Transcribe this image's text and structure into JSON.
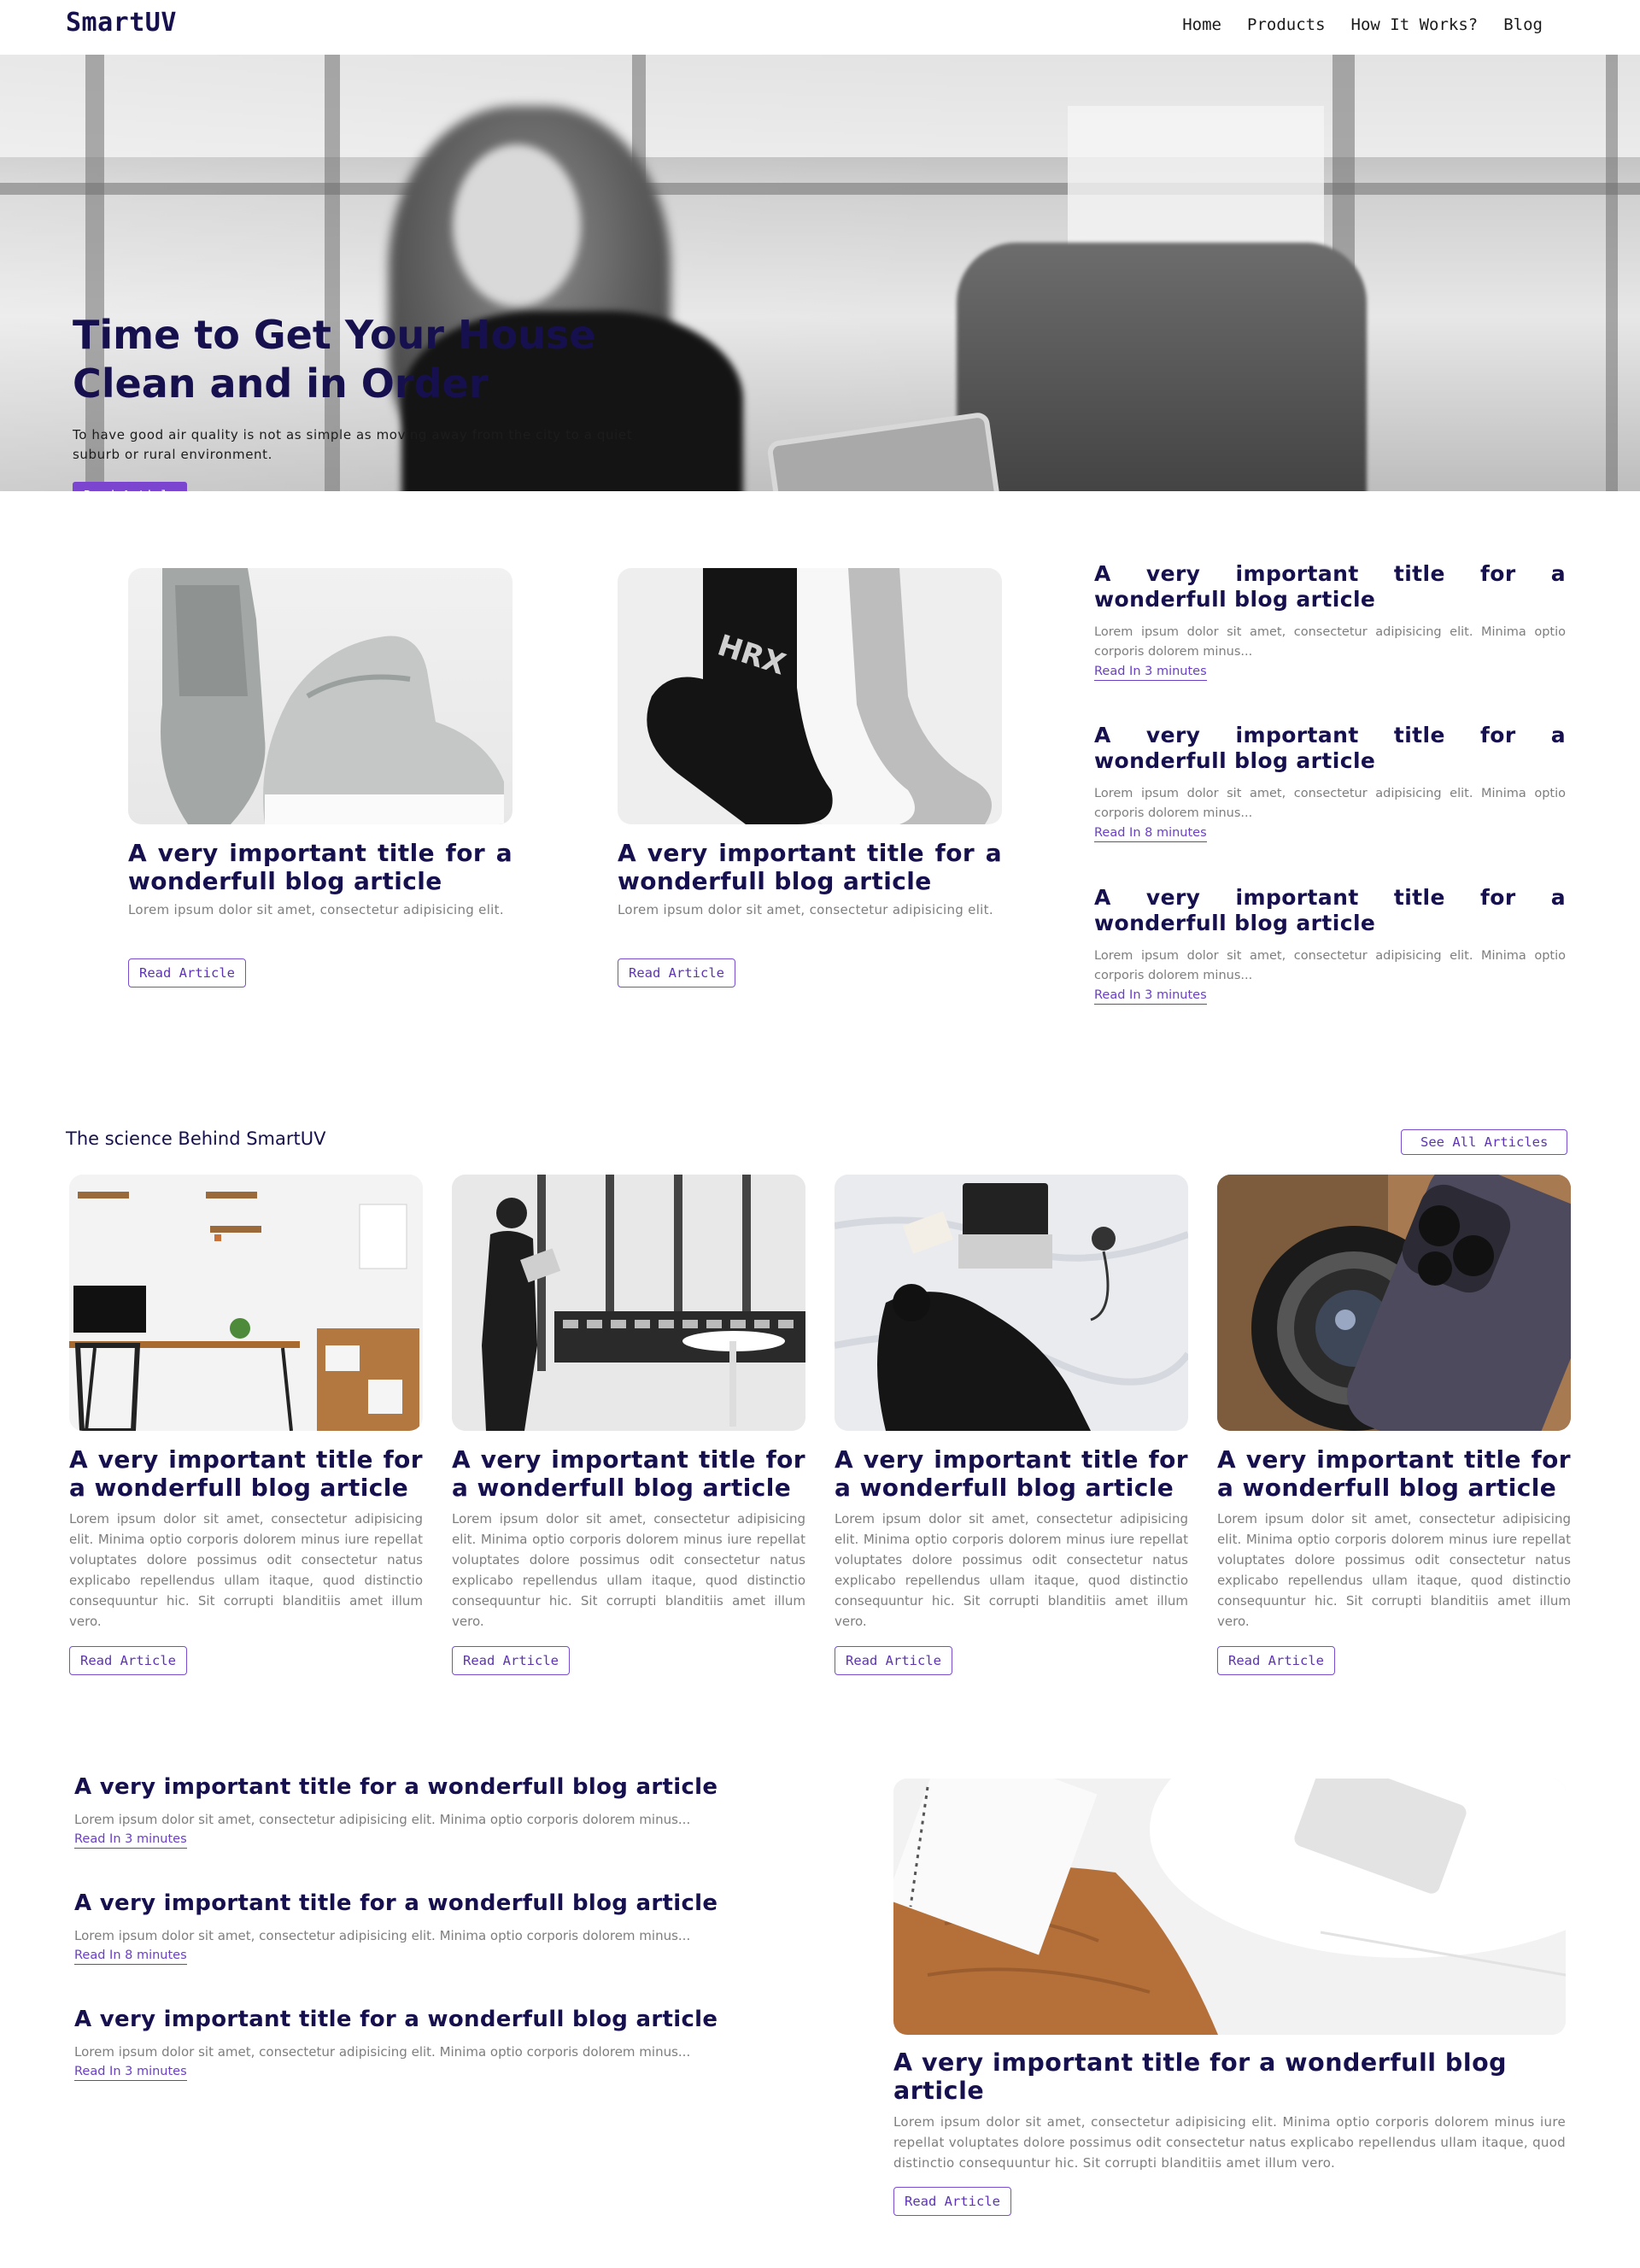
{
  "nav": {
    "logo": "SmartUV",
    "links": [
      "Home",
      "Products",
      "How It Works?",
      "Blog"
    ]
  },
  "hero": {
    "title_line1": "Time to Get Your House",
    "title_line2": "Clean and in Order",
    "text": "To have good air quality is not as simple as moving away from the city to a quiet suburb or rural environment.",
    "button": "Read Article"
  },
  "featured": {
    "cards": [
      {
        "image": "sneaker-photo",
        "title": "A very important title for a wonderfull blog article",
        "text": "Lorem ipsum dolor sit amet, consectetur adipisicing elit.",
        "button": "Read Article"
      },
      {
        "image": "socks-photo",
        "title": "A very important title for a wonderfull blog article",
        "text": "Lorem ipsum dolor sit amet, consectetur adipisicing elit.",
        "button": "Read Article"
      }
    ],
    "side": [
      {
        "title": "A very important title for a wonderfull blog article",
        "text": "Lorem ipsum dolor sit amet, consectetur adipisicing elit. Minima optio corporis dolorem minus...",
        "link": "Read In 3 minutes"
      },
      {
        "title": "A very important title for a wonderfull blog article",
        "text": "Lorem ipsum dolor sit amet, consectetur adipisicing elit. Minima optio corporis dolorem minus...",
        "link": "Read In 8 minutes"
      },
      {
        "title": "A very important title for a wonderfull blog article",
        "text": "Lorem ipsum dolor sit amet, consectetur adipisicing elit. Minima optio corporis dolorem minus...",
        "link": "Read In 3 minutes"
      }
    ]
  },
  "science": {
    "heading": "The science Behind SmartUV",
    "see_all": "See All Articles",
    "cards": [
      {
        "title": "A very important title for a wonderfull blog article",
        "text": "Lorem ipsum dolor sit amet, consectetur adipisicing elit. Minima optio corporis dolorem minus iure repellat voluptates dolore possimus odit consectetur natus explicabo repellendus ullam itaque, quod distinctio consequuntur hic. Sit corrupti blanditiis amet illum vero.",
        "button": "Read Article"
      },
      {
        "title": "A very important title for a wonderfull blog article",
        "text": "Lorem ipsum dolor sit amet, consectetur adipisicing elit. Minima optio corporis dolorem minus iure repellat voluptates dolore possimus odit consectetur natus explicabo repellendus ullam itaque, quod distinctio consequuntur hic. Sit corrupti blanditiis amet illum vero.",
        "button": "Read Article"
      },
      {
        "title": "A very important title for a wonderfull blog article",
        "text": "Lorem ipsum dolor sit amet, consectetur adipisicing elit. Minima optio corporis dolorem minus iure repellat voluptates dolore possimus odit consectetur natus explicabo repellendus ullam itaque, quod distinctio consequuntur hic. Sit corrupti blanditiis amet illum vero.",
        "button": "Read Article"
      },
      {
        "title": "A very important title for a wonderfull blog article",
        "text": "Lorem ipsum dolor sit amet, consectetur adipisicing elit. Minima optio corporis dolorem minus iure repellat voluptates dolore possimus odit consectetur natus explicabo repellendus ullam itaque, quod distinctio consequuntur hic. Sit corrupti blanditiis amet illum vero.",
        "button": "Read Article"
      }
    ]
  },
  "more": {
    "list": [
      {
        "title": "A very important title for a wonderfull blog article",
        "text": "Lorem ipsum dolor sit amet, consectetur adipisicing elit. Minima optio corporis dolorem minus...",
        "link": "Read In 3 minutes"
      },
      {
        "title": "A very important title for a wonderfull blog article",
        "text": "Lorem ipsum dolor sit amet, consectetur adipisicing elit. Minima optio corporis dolorem minus...",
        "link": "Read In 8 minutes"
      },
      {
        "title": "A very important title for a wonderfull blog article",
        "text": "Lorem ipsum dolor sit amet, consectetur adipisicing elit. Minima optio corporis dolorem minus...",
        "link": "Read In 3 minutes"
      }
    ],
    "big": {
      "title": "A very important title for a wonderfull blog article",
      "text": "Lorem ipsum dolor sit amet, consectetur adipisicing elit. Minima optio corporis dolorem minus iure repellat voluptates dolore possimus odit consectetur natus explicabo repellendus ullam itaque, quod distinctio consequuntur hic. Sit corrupti blanditiis amet illum vero.",
      "button": "Read Article"
    }
  },
  "colors": {
    "brand": "#16104f",
    "accent": "#7b45cf",
    "muted": "#7e7e7e"
  }
}
